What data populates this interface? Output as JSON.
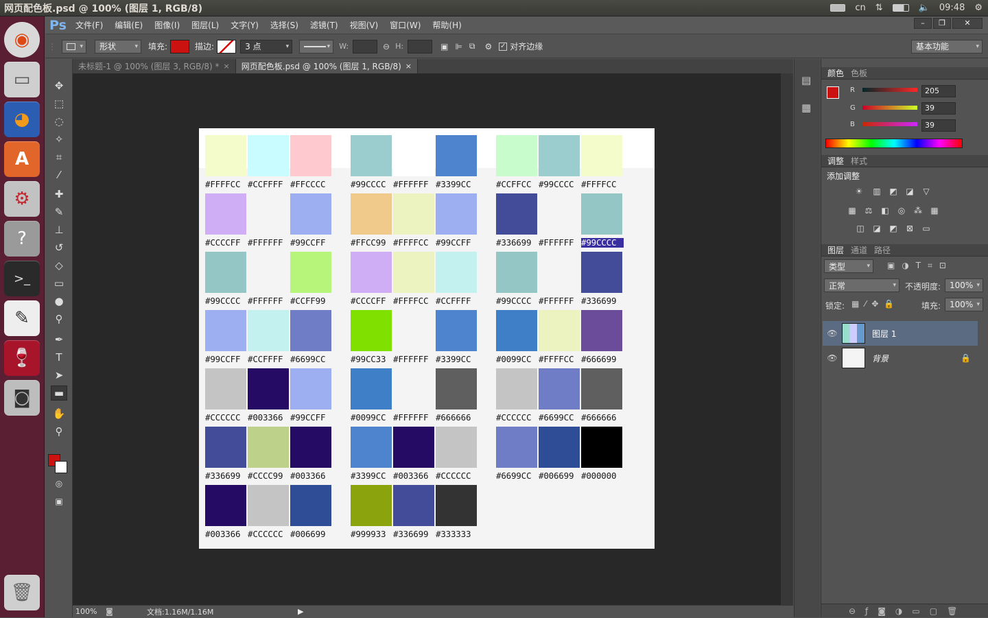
{
  "topbar": {
    "title": "网页配色板.psd @ 100% (图层 1, RGB/8)",
    "lang": "cn",
    "time": "09:48"
  },
  "menu": {
    "logo": "Ps",
    "items": [
      "文件(F)",
      "编辑(E)",
      "图像(I)",
      "图层(L)",
      "文字(Y)",
      "选择(S)",
      "滤镜(T)",
      "视图(V)",
      "窗口(W)",
      "帮助(H)"
    ]
  },
  "options": {
    "shape_mode": "形状",
    "fill_label": "填充:",
    "stroke_label": "描边:",
    "stroke_size": "3 点",
    "w_label": "W:",
    "h_label": "H:",
    "align_edges": "对齐边缘",
    "workspace": "基本功能"
  },
  "tabs": [
    {
      "label": "未标题-1 @ 100% (图层 3, RGB/8) *"
    },
    {
      "label": "网页配色板.psd @ 100% (图层 1, RGB/8)"
    }
  ],
  "palette": {
    "groups": [
      [
        [
          [
            "#FFFFCC",
            "#F5FCCC"
          ],
          [
            "#CCFFFF",
            "#C9FCFF"
          ],
          [
            "#FFCCCC",
            "#FFCACF"
          ]
        ],
        [
          [
            "#CCCCFF",
            "#CFAEF6"
          ],
          [
            "#FFFFFF",
            "#F4F4F4"
          ],
          [
            "#99CCFF",
            "#9DAFF0"
          ]
        ],
        [
          [
            "#99CCCC",
            "#93C6C5"
          ],
          [
            "#FFFFFF",
            "#F4F4F4"
          ],
          [
            "#CCFF99",
            "#B6F47A"
          ]
        ],
        [
          [
            "#99CCFF",
            "#9DAFF0"
          ],
          [
            "#CCFFFF",
            "#C3F1F0"
          ],
          [
            "#6699CC",
            "#6F7CC6"
          ]
        ],
        [
          [
            "#CCCCCC",
            "#C4C4C4"
          ],
          [
            "#003366",
            "#250B63"
          ],
          [
            "#99CCFF",
            "#9DAFF0"
          ]
        ],
        [
          [
            "#336699",
            "#424C98"
          ],
          [
            "#CCCC99",
            "#BDD18B"
          ],
          [
            "#003366",
            "#250B63"
          ]
        ],
        [
          [
            "#003366",
            "#250B63"
          ],
          [
            "#CCCCCC",
            "#C4C4C4"
          ],
          [
            "#006699",
            "#2F4C96"
          ]
        ]
      ],
      [
        [
          [
            "#99CCCC",
            "#9CCDCE"
          ],
          [
            "#FFFFFF",
            "#FFFFFF"
          ],
          [
            "#3399CC",
            "#4E84CE"
          ]
        ],
        [
          [
            "#FFCC99",
            "#EFCA8A"
          ],
          [
            "#FFFFCC",
            "#EDF3C0"
          ],
          [
            "#99CCFF",
            "#9DAFF0"
          ]
        ],
        [
          [
            "#CCCCFF",
            "#CFAEF6"
          ],
          [
            "#FFFFCC",
            "#EDF3C0"
          ],
          [
            "#CCFFFF",
            "#C3F1F0"
          ]
        ],
        [
          [
            "#99CC33",
            "#80E000"
          ],
          [
            "#FFFFFF",
            "#F4F4F4"
          ],
          [
            "#3399CC",
            "#4E84CE"
          ]
        ],
        [
          [
            "#0099CC",
            "#3E7FC8"
          ],
          [
            "#FFFFFF",
            "#F4F4F4"
          ],
          [
            "#666666",
            "#5F5F5F"
          ]
        ],
        [
          [
            "#3399CC",
            "#4E84CE"
          ],
          [
            "#003366",
            "#250B63"
          ],
          [
            "#CCCCCC",
            "#C4C4C4"
          ]
        ],
        [
          [
            "#999933",
            "#8BA40E"
          ],
          [
            "#336699",
            "#424C98"
          ],
          [
            "#333333",
            "#333333"
          ]
        ]
      ],
      [
        [
          [
            "#CCFFCC",
            "#C8FCCC"
          ],
          [
            "#99CCCC",
            "#9CCDCE"
          ],
          [
            "#FFFFCC",
            "#F5FCCC"
          ]
        ],
        [
          [
            "#336699",
            "#424C98"
          ],
          [
            "#FFFFFF",
            "#F4F4F4"
          ],
          [
            "#99CCCC",
            "#93C6C5"
          ]
        ],
        [
          [
            "#99CCCC",
            "#93C6C5"
          ],
          [
            "#FFFFFF",
            "#F4F4F4"
          ],
          [
            "#336699",
            "#424C98"
          ]
        ],
        [
          [
            "#0099CC",
            "#3E7FC8"
          ],
          [
            "#FFFFCC",
            "#EDF3C0"
          ],
          [
            "#666699",
            "#6A4C9B"
          ]
        ],
        [
          [
            "#CCCCCC",
            "#C4C4C4"
          ],
          [
            "#6699CC",
            "#6F7CC6"
          ],
          [
            "#666666",
            "#5F5F5F"
          ]
        ],
        [
          [
            "#6699CC",
            "#6F7CC6"
          ],
          [
            "#006699",
            "#2F4C96"
          ],
          [
            "#000000",
            "#000000"
          ]
        ]
      ]
    ],
    "highlight": [
      2,
      1,
      2
    ]
  },
  "status": {
    "zoom": "100%",
    "doc": "文档:1.16M/1.16M"
  },
  "color_panel": {
    "tabs": [
      "颜色",
      "色板"
    ],
    "r": "205",
    "g": "39",
    "b": "39",
    "fg": "#CD2727"
  },
  "adjust_panel": {
    "tabs": [
      "调整",
      "样式"
    ],
    "title": "添加调整"
  },
  "layers_panel": {
    "tabs": [
      "图层",
      "通道",
      "路径"
    ],
    "kind": "类型",
    "blend": "正常",
    "opacity_label": "不透明度:",
    "opacity": "100%",
    "lock_label": "锁定:",
    "fill_label": "填充:",
    "fill": "100%",
    "layers": [
      "图层 1",
      "背景"
    ]
  }
}
